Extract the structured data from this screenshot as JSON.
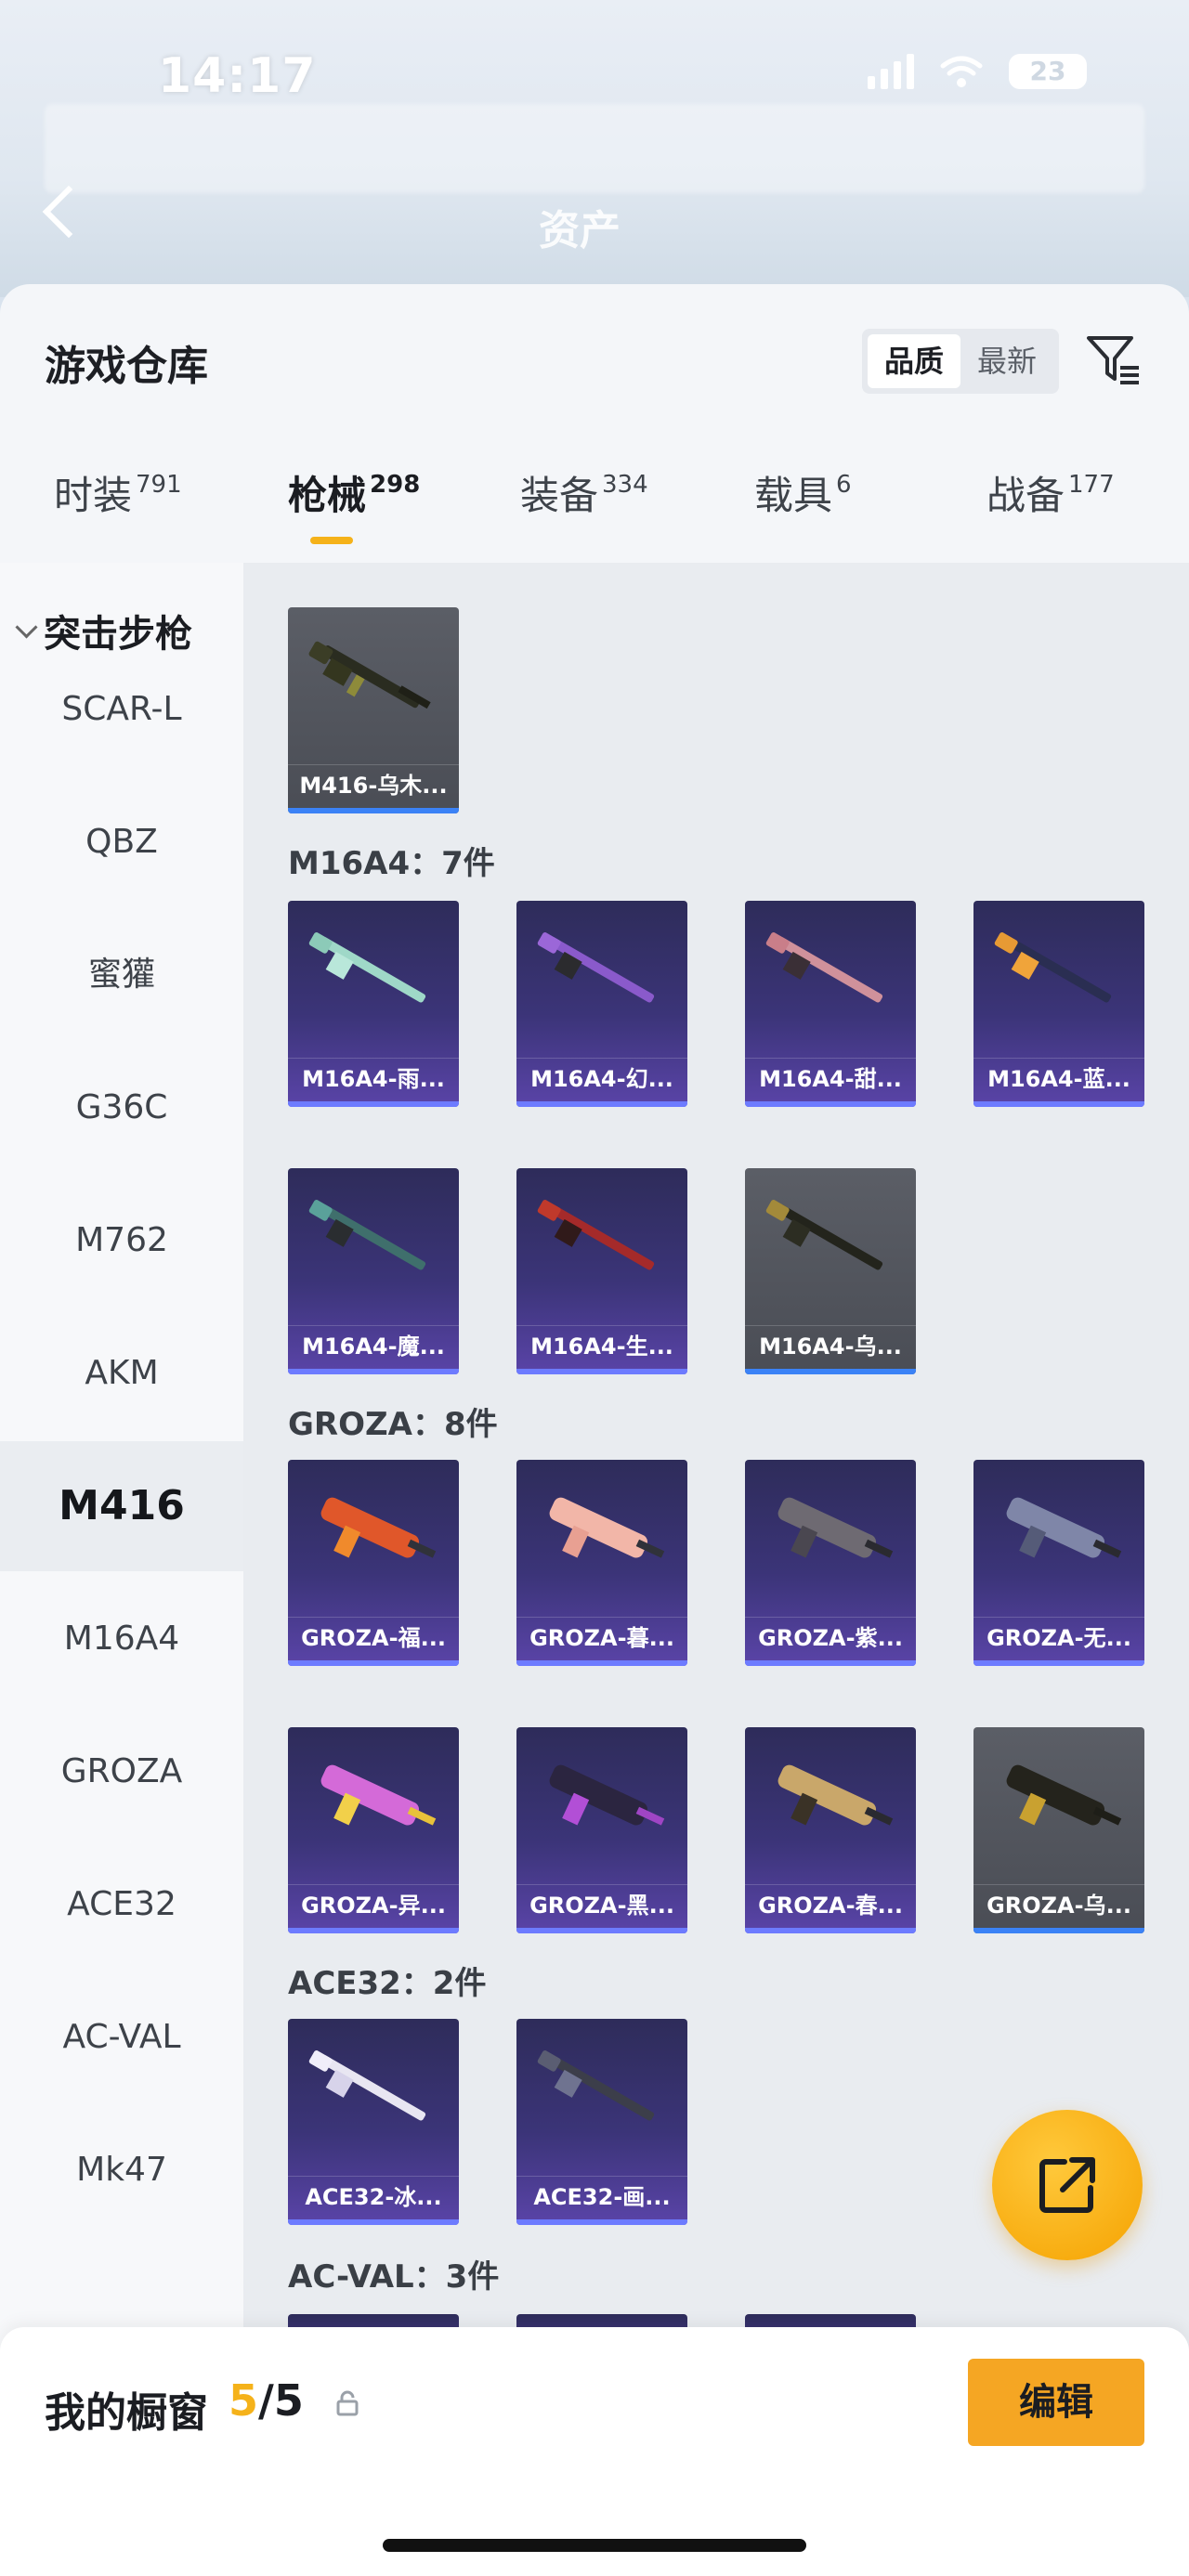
{
  "status": {
    "time": "14:17",
    "battery": "23"
  },
  "header": {
    "ghost_title": "资产"
  },
  "sheet": {
    "title": "游戏仓库",
    "sort": [
      "品质",
      "最新"
    ],
    "sort_active": "品质"
  },
  "tabs": [
    {
      "label": "时装",
      "count": "791"
    },
    {
      "label": "枪械",
      "count": "298"
    },
    {
      "label": "装备",
      "count": "334"
    },
    {
      "label": "载具",
      "count": "6"
    },
    {
      "label": "战备",
      "count": "177"
    }
  ],
  "sidebar": {
    "header": "突击步枪",
    "items": [
      "SCAR-L",
      "QBZ",
      "蜜獾",
      "G36C",
      "M762",
      "AKM",
      "M416",
      "M16A4",
      "GROZA",
      "ACE32",
      "AC-VAL",
      "Mk47"
    ],
    "active": "M416"
  },
  "content": {
    "m416_items": [
      "M416-乌木..."
    ],
    "groups": [
      {
        "title": "M16A4：7件",
        "items": [
          "M16A4-雨...",
          "M16A4-幻...",
          "M16A4-甜...",
          "M16A4-蓝...",
          "M16A4-魔...",
          "M16A4-生...",
          "M16A4-乌..."
        ]
      },
      {
        "title": "GROZA：8件",
        "items": [
          "GROZA-福...",
          "GROZA-暮...",
          "GROZA-紫...",
          "GROZA-无...",
          "GROZA-异...",
          "GROZA-黑...",
          "GROZA-春...",
          "GROZA-乌..."
        ]
      },
      {
        "title": "ACE32：2件",
        "items": [
          "ACE32-冰...",
          "ACE32-画..."
        ]
      },
      {
        "title": "AC-VAL：3件",
        "items": []
      }
    ]
  },
  "showcase": {
    "title": "我的橱窗",
    "count_current": "5",
    "count_total": "/5",
    "edit_label": "编辑"
  },
  "colors": {
    "accent": "#f5b21a",
    "card_purple": "#3b3478",
    "card_grey": "#4a4d55"
  }
}
